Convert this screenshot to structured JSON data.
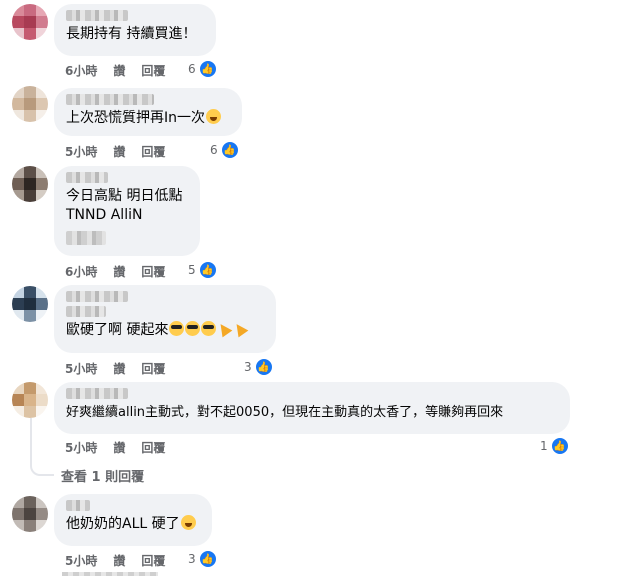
{
  "comments": [
    {
      "text": "長期持有 持續買進！",
      "time": "6小時",
      "like": "讚",
      "reply": "回覆",
      "likes": "6"
    },
    {
      "text": "上次恐慌質押再In一次",
      "time": "5小時",
      "like": "讚",
      "reply": "回覆",
      "likes": "6"
    },
    {
      "text": "今日高點 明日低點",
      "text2": "TNND AlliN",
      "time": "6小時",
      "like": "讚",
      "reply": "回覆",
      "likes": "5"
    },
    {
      "text": "歐硬了啊 硬起來",
      "time": "5小時",
      "like": "讚",
      "reply": "回覆",
      "likes": "3"
    },
    {
      "text": "好爽繼續allin主動式，對不起0050，但現在主動真的太香了，等賺夠再回來",
      "time": "5小時",
      "like": "讚",
      "reply": "回覆",
      "likes": "1"
    },
    {
      "text": "他奶奶的ALL 硬了",
      "time": "5小時",
      "like": "讚",
      "reply": "回覆",
      "likes": "3"
    }
  ],
  "view_replies": "查看 1 則回覆",
  "icons": {
    "like": "thumbs-up-icon"
  },
  "colors": {
    "like_badge": "#1877f2",
    "bubble": "#f0f2f5",
    "meta_text": "#65676b"
  }
}
